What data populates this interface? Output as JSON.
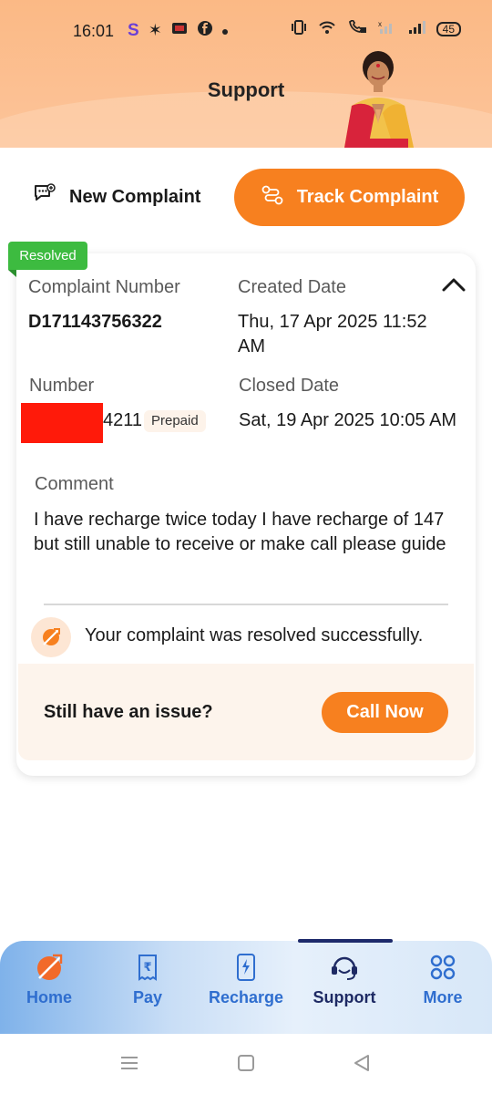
{
  "status_bar": {
    "time": "16:01",
    "left_letter": "S",
    "battery": "45"
  },
  "header": {
    "title": "Support"
  },
  "actions": {
    "new_complaint": "New Complaint",
    "track_complaint": "Track Complaint"
  },
  "complaint": {
    "status_badge": "Resolved",
    "complaint_number_label": "Complaint Number",
    "complaint_number": "D171143756322",
    "created_date_label": "Created Date",
    "created_date": "Thu, 17 Apr 2025 11:52 AM",
    "number_label": "Number",
    "number_suffix": "4211",
    "plan_type": "Prepaid",
    "closed_date_label": "Closed Date",
    "closed_date": "Sat, 19 Apr 2025 10:05 AM",
    "comment_label": "Comment",
    "comment": "I have recharge twice today I have recharge of 147 but still unable to receive or make call please guide",
    "resolution_message": "Your complaint was resolved successfully.",
    "issue_prompt": "Still have an issue?",
    "call_now": "Call Now"
  },
  "bottom_nav": {
    "items": [
      {
        "label": "Home",
        "icon": "home-logo-icon"
      },
      {
        "label": "Pay",
        "icon": "rupee-receipt-icon"
      },
      {
        "label": "Recharge",
        "icon": "phone-charge-icon"
      },
      {
        "label": "Support",
        "icon": "headset-icon"
      },
      {
        "label": "More",
        "icon": "grid-dots-icon"
      }
    ],
    "active": "Support"
  },
  "colors": {
    "accent": "#f7801f",
    "resolved": "#3dbb40",
    "nav_blue": "#2f6ecf",
    "nav_active": "#1e2a64"
  }
}
